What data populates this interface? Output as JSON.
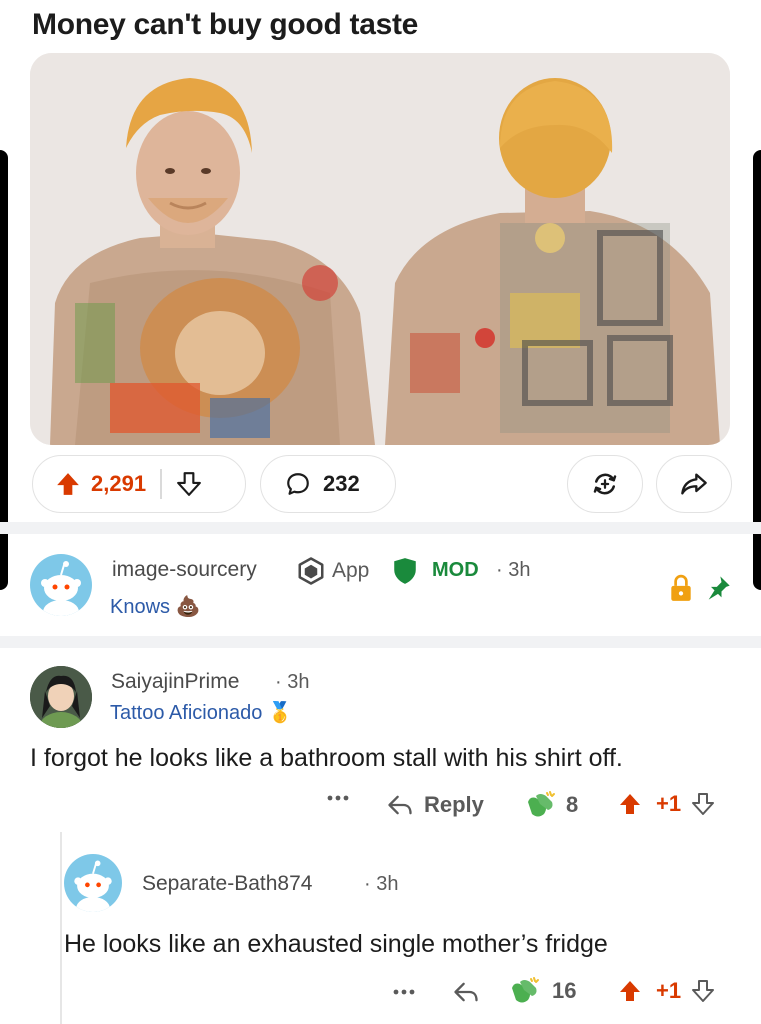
{
  "post": {
    "title": "Money can't buy good taste",
    "image_alt": "Man with orange hair showing heavily tattooed chest and back",
    "votes": "2,291",
    "comments": "232"
  },
  "mod_comment": {
    "username": "image-sourcery",
    "app_label": "App",
    "mod_label": "MOD",
    "time": "3h",
    "flair": "Knows"
  },
  "comment1": {
    "username": "SaiyajinPrime",
    "time": "3h",
    "flair": "Tattoo Aficionado",
    "body": "I forgot he looks like a bathroom stall with his shirt off.",
    "reply_label": "Reply",
    "award_count": "8",
    "score": "+1"
  },
  "comment2": {
    "username": "Separate-Bath874",
    "time": "3h",
    "body": "He looks like an exhausted single mother’s fridge",
    "award_count": "16",
    "score": "+1"
  },
  "icons": {
    "upvote": "upvote-arrow-icon",
    "downvote": "downvote-arrow-icon",
    "comment": "comment-bubble-icon",
    "award": "award-icon",
    "share": "share-arrow-icon",
    "lock": "lock-icon",
    "pin": "pin-icon",
    "reply": "reply-arrow-icon",
    "more": "more-options-icon"
  },
  "colors": {
    "upvote": "#d93a00",
    "mod": "#1a8a3c",
    "flair": "#2c5aa8",
    "lock": "#f0a012"
  }
}
